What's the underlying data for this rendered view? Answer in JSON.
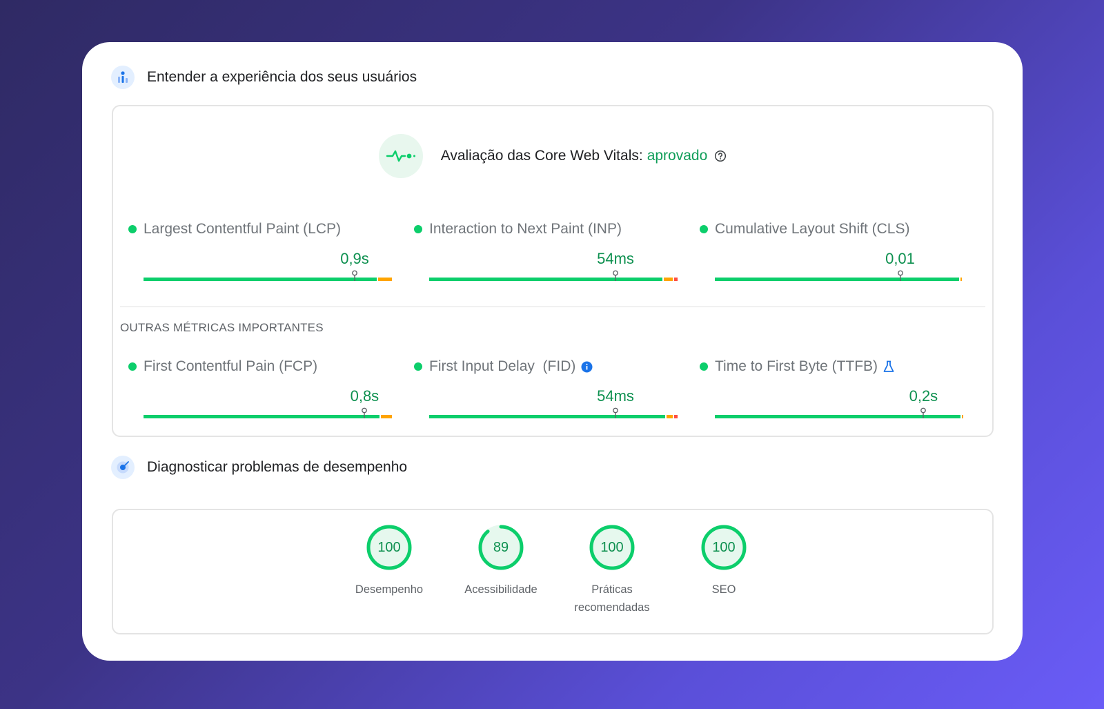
{
  "section_ux": {
    "title": "Entender a experiência dos seus usuários"
  },
  "cwv": {
    "prefix": "Avaliação das Core Web Vitals:",
    "status": "aprovado"
  },
  "core_metrics": [
    {
      "label": "Largest Contentful Paint (LCP)",
      "value": "0,9s",
      "position": 0.85
    },
    {
      "label": "Interaction to Next Paint (INP)",
      "value": "54ms",
      "position": 0.75
    },
    {
      "label": "Cumulative Layout Shift (CLS)",
      "value": "0,01",
      "position": 0.75
    }
  ],
  "other_metrics_title": "OUTRAS MÉTRICAS IMPORTANTES",
  "other_metrics": [
    {
      "label": "First Contentful Pain (FCP)",
      "value": "0,8s",
      "position": 0.89
    },
    {
      "label": "First Input Delay  (FID)",
      "value": "54ms",
      "position": 0.75,
      "icon": "info-icon"
    },
    {
      "label": "Time to First Byte (TTFB)",
      "value": "0,2s",
      "position": 0.84,
      "icon": "flask-icon"
    }
  ],
  "section_diag": {
    "title": "Diagnosticar problemas de desempenho"
  },
  "scores": [
    {
      "value": "100",
      "score": 100,
      "label": "Desempenho"
    },
    {
      "value": "89",
      "score": 89,
      "label": "Acessibilidade"
    },
    {
      "value": "100",
      "score": 100,
      "label": "Práticas recomendadas"
    },
    {
      "value": "100",
      "score": 100,
      "label": "SEO"
    }
  ],
  "colors": {
    "good": "#0cce6b",
    "average": "#ffa400",
    "poor": "#ff4e42",
    "good_text": "#0d904f"
  }
}
